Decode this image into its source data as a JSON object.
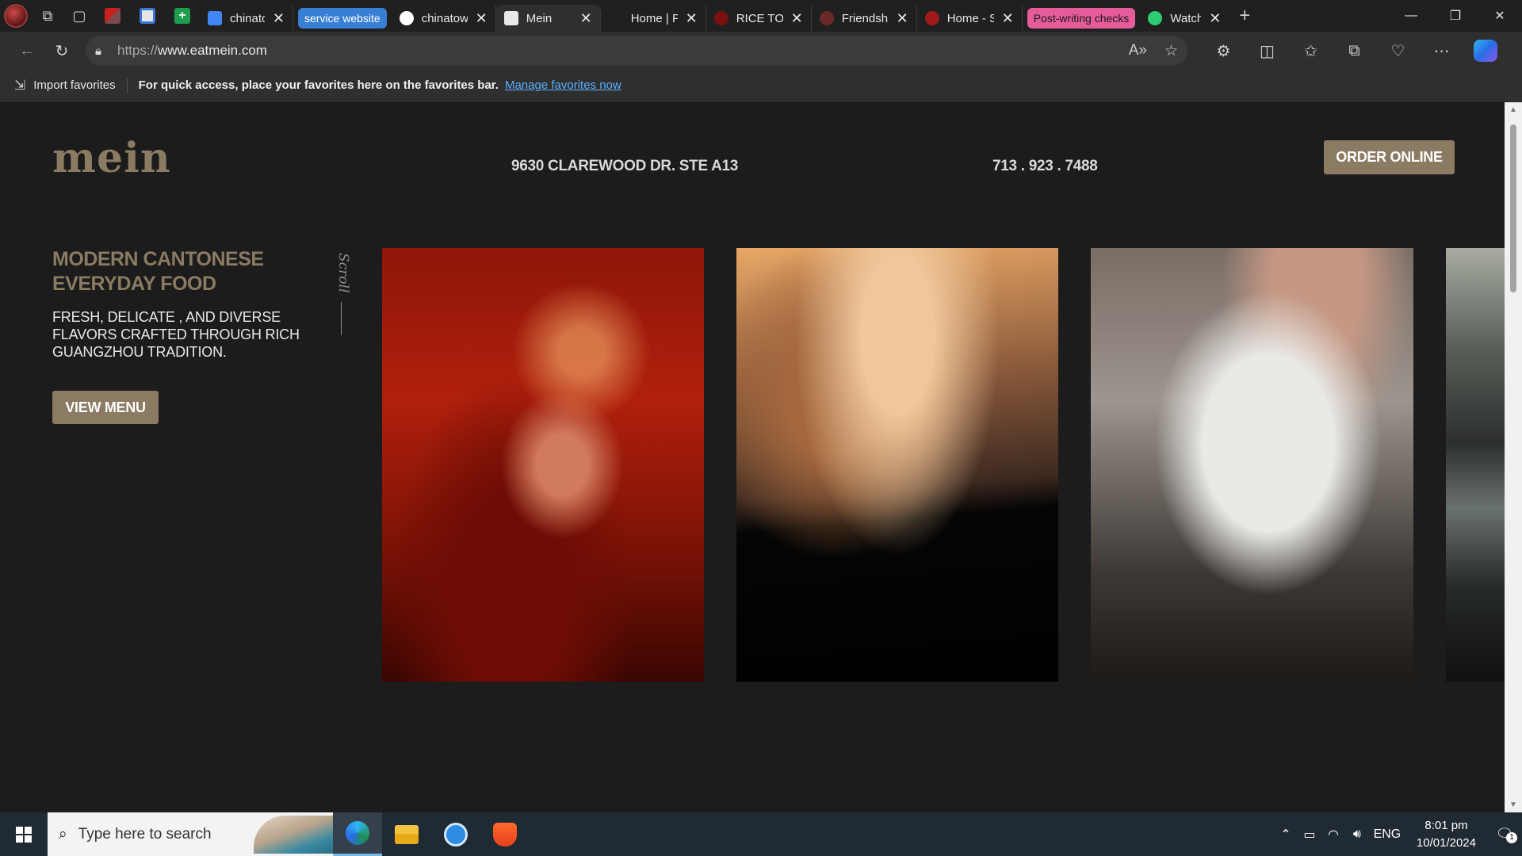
{
  "browser": {
    "tabs": [
      {
        "title": "chinatown",
        "favicon_color": "#4285f4"
      },
      {
        "title": "chinatown",
        "favicon_color": "#ffffff"
      },
      {
        "title": "Mein",
        "favicon_color": "#eeeeee"
      },
      {
        "title": "Home | Pinkatea",
        "favicon_color": "#202020"
      },
      {
        "title": "RICE TO",
        "favicon_color": "#b22222"
      },
      {
        "title": "Friendship",
        "favicon_color": "#7a2a2a"
      },
      {
        "title": "Home - Stoopinc",
        "favicon_color": "#b22222"
      },
      {
        "title": "Watch Transfer",
        "favicon_color": "#2ecc71"
      }
    ],
    "tab_groups": {
      "service": "service website",
      "postwriting": "Post-writing checks"
    },
    "address": {
      "protocol": "https://",
      "host": "www.eatmein.com"
    },
    "favorites_bar": {
      "import_label": "Import favorites",
      "message": "For quick access, place your favorites here on the favorites bar.",
      "link": "Manage favorites now"
    }
  },
  "site": {
    "logo": "mein",
    "address": "9630 CLAREWOOD DR. STE A13",
    "phone": "713 . 923 . 7488",
    "order_button": "ORDER ONLINE",
    "headline": "MODERN CANTONESE EVERYDAY FOOD",
    "tagline": "FRESH, DELICATE , AND DIVERSE FLAVORS CRAFTED THROUGH RICH GUANGZHOU TRADITION.",
    "menu_button": "VIEW MENU",
    "scroll_hint": "Scroll",
    "accent_color": "#8a7b62"
  },
  "taskbar": {
    "search_placeholder": "Type here to search",
    "language": "ENG",
    "time": "8:01 pm",
    "date": "10/01/2024",
    "notifications": "1"
  }
}
